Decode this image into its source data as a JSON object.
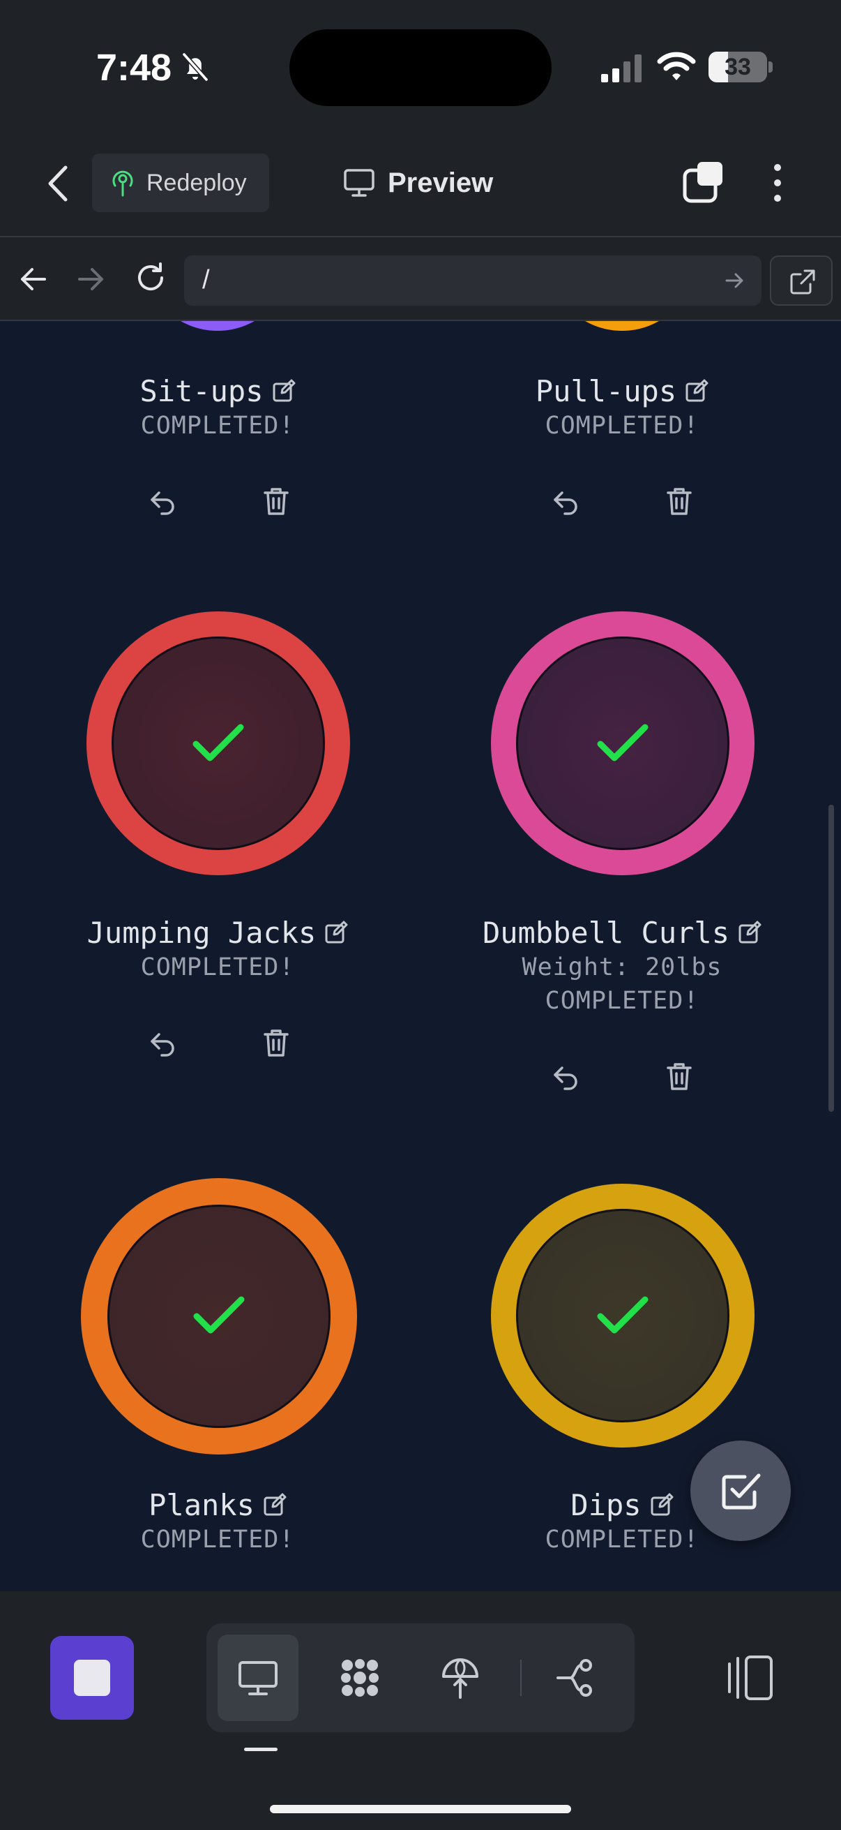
{
  "status_bar": {
    "time": "7:48",
    "battery": "33",
    "battery_level": 0.33
  },
  "header": {
    "redeploy_label": "Redeploy",
    "title": "Preview"
  },
  "browser": {
    "url": "/"
  },
  "exercises": [
    {
      "name": "Sit-ups",
      "detail": "",
      "status": "COMPLETED!",
      "color": "#8b5cf6"
    },
    {
      "name": "Pull-ups",
      "detail": "",
      "status": "COMPLETED!",
      "color": "#f59e0b"
    },
    {
      "name": "Jumping Jacks",
      "detail": "",
      "status": "COMPLETED!",
      "color": "#dc4343"
    },
    {
      "name": "Dumbbell Curls",
      "detail": "Weight: 20lbs",
      "status": "COMPLETED!",
      "color": "#db4a96"
    },
    {
      "name": "Planks",
      "detail": "",
      "status": "COMPLETED!",
      "color": "#e8721e"
    },
    {
      "name": "Dips",
      "detail": "",
      "status": "COMPLETED!",
      "color": "#d6a20f"
    }
  ],
  "colors": {
    "background": "#111a2c",
    "chrome": "#1f2227",
    "check": "#22e04a",
    "accent": "#5a3fd1"
  },
  "icons": {
    "status": [
      "bell-slash-icon",
      "signal-icon",
      "wifi-icon",
      "battery-icon"
    ],
    "header": [
      "chevron-left-icon",
      "antenna-icon",
      "monitor-icon",
      "tabs-icon",
      "more-vertical-icon"
    ],
    "browser": [
      "arrow-left-icon",
      "arrow-right-icon",
      "reload-icon",
      "arrow-go-icon",
      "external-link-icon"
    ],
    "card_actions": [
      "undo-icon",
      "trash-icon",
      "edit-icon",
      "checkmark-icon"
    ],
    "toolbar": [
      "stop-icon",
      "monitor-icon",
      "apps-icon",
      "deploy-icon",
      "branch-icon",
      "device-toggle-icon"
    ],
    "fab": "checkbox-icon"
  }
}
